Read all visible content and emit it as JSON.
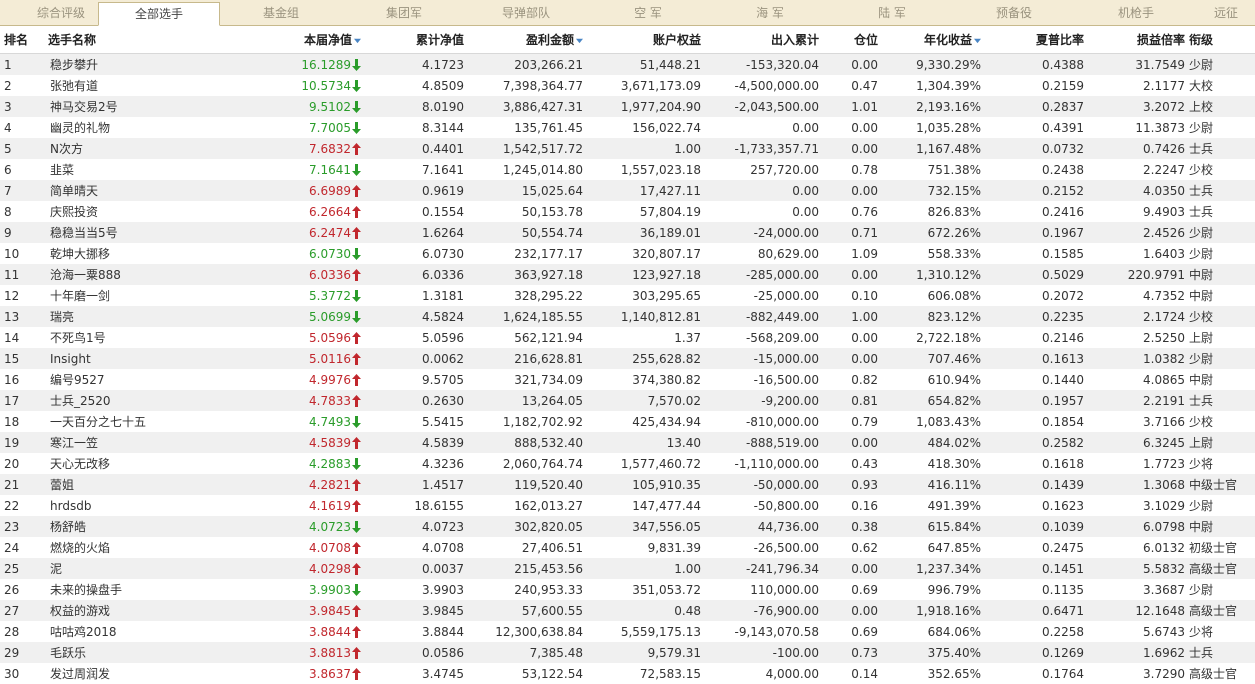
{
  "tabs": [
    {
      "label": "综合评级",
      "active": false
    },
    {
      "label": "全部选手",
      "active": true
    },
    {
      "label": "基金组",
      "active": false
    },
    {
      "label": "集团军",
      "active": false
    },
    {
      "label": "导弹部队",
      "active": false
    },
    {
      "label": "空  军",
      "active": false
    },
    {
      "label": "海  军",
      "active": false
    },
    {
      "label": "陆  军",
      "active": false
    },
    {
      "label": "预备役",
      "active": false
    },
    {
      "label": "机枪手",
      "active": false
    },
    {
      "label": "远征",
      "active": false
    }
  ],
  "columns": [
    {
      "label": "排名",
      "sortable": false
    },
    {
      "label": "选手名称",
      "sortable": false
    },
    {
      "label": "本届净值",
      "sortable": true
    },
    {
      "label": "累计净值",
      "sortable": false
    },
    {
      "label": "盈利金额",
      "sortable": true
    },
    {
      "label": "账户权益",
      "sortable": false
    },
    {
      "label": "出入累计",
      "sortable": false
    },
    {
      "label": "仓位",
      "sortable": false
    },
    {
      "label": "年化收益",
      "sortable": true
    },
    {
      "label": "夏普比率",
      "sortable": false
    },
    {
      "label": "损益倍率",
      "sortable": false
    },
    {
      "label": "衔级",
      "sortable": false
    }
  ],
  "colors": {
    "up": "#c1272d",
    "down": "#2a9c2a",
    "sort_icon": "#4a86c5"
  },
  "rows": [
    {
      "rank": "1",
      "name": "稳步攀升",
      "nav": "16.1289",
      "trend": "down",
      "cum_nav": "4.1723",
      "profit": "203,266.21",
      "equity": "51,448.21",
      "flow": "-153,320.04",
      "position": "0.00",
      "annual": "9,330.29%",
      "sharpe": "0.4388",
      "pl_ratio": "31.7549",
      "grade": "少尉"
    },
    {
      "rank": "2",
      "name": "张弛有道",
      "nav": "10.5734",
      "trend": "down",
      "cum_nav": "4.8509",
      "profit": "7,398,364.77",
      "equity": "3,671,173.09",
      "flow": "-4,500,000.00",
      "position": "0.47",
      "annual": "1,304.39%",
      "sharpe": "0.2159",
      "pl_ratio": "2.1177",
      "grade": "大校"
    },
    {
      "rank": "3",
      "name": "神马交易2号",
      "nav": "9.5102",
      "trend": "down",
      "cum_nav": "8.0190",
      "profit": "3,886,427.31",
      "equity": "1,977,204.90",
      "flow": "-2,043,500.00",
      "position": "1.01",
      "annual": "2,193.16%",
      "sharpe": "0.2837",
      "pl_ratio": "3.2072",
      "grade": "上校"
    },
    {
      "rank": "4",
      "name": "幽灵的礼物",
      "nav": "7.7005",
      "trend": "down",
      "cum_nav": "8.3144",
      "profit": "135,761.45",
      "equity": "156,022.74",
      "flow": "0.00",
      "position": "0.00",
      "annual": "1,035.28%",
      "sharpe": "0.4391",
      "pl_ratio": "11.3873",
      "grade": "少尉"
    },
    {
      "rank": "5",
      "name": "N次方",
      "nav": "7.6832",
      "trend": "up",
      "cum_nav": "0.4401",
      "profit": "1,542,517.72",
      "equity": "1.00",
      "flow": "-1,733,357.71",
      "position": "0.00",
      "annual": "1,167.48%",
      "sharpe": "0.0732",
      "pl_ratio": "0.7426",
      "grade": "士兵"
    },
    {
      "rank": "6",
      "name": "韭菜",
      "nav": "7.1641",
      "trend": "down",
      "cum_nav": "7.1641",
      "profit": "1,245,014.80",
      "equity": "1,557,023.18",
      "flow": "257,720.00",
      "position": "0.78",
      "annual": "751.38%",
      "sharpe": "0.2438",
      "pl_ratio": "2.2247",
      "grade": "少校"
    },
    {
      "rank": "7",
      "name": "简单晴天",
      "nav": "6.6989",
      "trend": "up",
      "cum_nav": "0.9619",
      "profit": "15,025.64",
      "equity": "17,427.11",
      "flow": "0.00",
      "position": "0.00",
      "annual": "732.15%",
      "sharpe": "0.2152",
      "pl_ratio": "4.0350",
      "grade": "士兵"
    },
    {
      "rank": "8",
      "name": "庆熙投资",
      "nav": "6.2664",
      "trend": "up",
      "cum_nav": "0.1554",
      "profit": "50,153.78",
      "equity": "57,804.19",
      "flow": "0.00",
      "position": "0.76",
      "annual": "826.83%",
      "sharpe": "0.2416",
      "pl_ratio": "9.4903",
      "grade": "士兵"
    },
    {
      "rank": "9",
      "name": "稳稳当当5号",
      "nav": "6.2474",
      "trend": "up",
      "cum_nav": "1.6264",
      "profit": "50,554.74",
      "equity": "36,189.01",
      "flow": "-24,000.00",
      "position": "0.71",
      "annual": "672.26%",
      "sharpe": "0.1967",
      "pl_ratio": "2.4526",
      "grade": "少尉"
    },
    {
      "rank": "10",
      "name": "乾坤大挪移",
      "nav": "6.0730",
      "trend": "down",
      "cum_nav": "6.0730",
      "profit": "232,177.17",
      "equity": "320,807.17",
      "flow": "80,629.00",
      "position": "1.09",
      "annual": "558.33%",
      "sharpe": "0.1585",
      "pl_ratio": "1.6403",
      "grade": "少尉"
    },
    {
      "rank": "11",
      "name": "沧海一粟888",
      "nav": "6.0336",
      "trend": "up",
      "cum_nav": "6.0336",
      "profit": "363,927.18",
      "equity": "123,927.18",
      "flow": "-285,000.00",
      "position": "0.00",
      "annual": "1,310.12%",
      "sharpe": "0.5029",
      "pl_ratio": "220.9791",
      "grade": "中尉"
    },
    {
      "rank": "12",
      "name": "十年磨一剑",
      "nav": "5.3772",
      "trend": "down",
      "cum_nav": "1.3181",
      "profit": "328,295.22",
      "equity": "303,295.65",
      "flow": "-25,000.00",
      "position": "0.10",
      "annual": "606.08%",
      "sharpe": "0.2072",
      "pl_ratio": "4.7352",
      "grade": "中尉"
    },
    {
      "rank": "13",
      "name": "瑞亮",
      "nav": "5.0699",
      "trend": "down",
      "cum_nav": "4.5824",
      "profit": "1,624,185.55",
      "equity": "1,140,812.81",
      "flow": "-882,449.00",
      "position": "1.00",
      "annual": "823.12%",
      "sharpe": "0.2235",
      "pl_ratio": "2.1724",
      "grade": "少校"
    },
    {
      "rank": "14",
      "name": "不死鸟1号",
      "nav": "5.0596",
      "trend": "up",
      "cum_nav": "5.0596",
      "profit": "562,121.94",
      "equity": "1.37",
      "flow": "-568,209.00",
      "position": "0.00",
      "annual": "2,722.18%",
      "sharpe": "0.2146",
      "pl_ratio": "2.5250",
      "grade": "上尉"
    },
    {
      "rank": "15",
      "name": "Insight",
      "nav": "5.0116",
      "trend": "up",
      "cum_nav": "0.0062",
      "profit": "216,628.81",
      "equity": "255,628.82",
      "flow": "-15,000.00",
      "position": "0.00",
      "annual": "707.46%",
      "sharpe": "0.1613",
      "pl_ratio": "1.0382",
      "grade": "少尉"
    },
    {
      "rank": "16",
      "name": "编号9527",
      "nav": "4.9976",
      "trend": "up",
      "cum_nav": "9.5705",
      "profit": "321,734.09",
      "equity": "374,380.82",
      "flow": "-16,500.00",
      "position": "0.82",
      "annual": "610.94%",
      "sharpe": "0.1440",
      "pl_ratio": "4.0865",
      "grade": "中尉"
    },
    {
      "rank": "17",
      "name": "士兵_2520",
      "nav": "4.7833",
      "trend": "up",
      "cum_nav": "0.2630",
      "profit": "13,264.05",
      "equity": "7,570.02",
      "flow": "-9,200.00",
      "position": "0.81",
      "annual": "654.82%",
      "sharpe": "0.1957",
      "pl_ratio": "2.2191",
      "grade": "士兵"
    },
    {
      "rank": "18",
      "name": "一天百分之七十五",
      "nav": "4.7493",
      "trend": "down",
      "cum_nav": "5.5415",
      "profit": "1,182,702.92",
      "equity": "425,434.94",
      "flow": "-810,000.00",
      "position": "0.79",
      "annual": "1,083.43%",
      "sharpe": "0.1854",
      "pl_ratio": "3.7166",
      "grade": "少校"
    },
    {
      "rank": "19",
      "name": "寒江一笠",
      "nav": "4.5839",
      "trend": "up",
      "cum_nav": "4.5839",
      "profit": "888,532.40",
      "equity": "13.40",
      "flow": "-888,519.00",
      "position": "0.00",
      "annual": "484.02%",
      "sharpe": "0.2582",
      "pl_ratio": "6.3245",
      "grade": "上尉"
    },
    {
      "rank": "20",
      "name": "天心无改移",
      "nav": "4.2883",
      "trend": "down",
      "cum_nav": "4.3236",
      "profit": "2,060,764.74",
      "equity": "1,577,460.72",
      "flow": "-1,110,000.00",
      "position": "0.43",
      "annual": "418.30%",
      "sharpe": "0.1618",
      "pl_ratio": "1.7723",
      "grade": "少将"
    },
    {
      "rank": "21",
      "name": "蕾姐",
      "nav": "4.2821",
      "trend": "up",
      "cum_nav": "1.4517",
      "profit": "119,520.40",
      "equity": "105,910.35",
      "flow": "-50,000.00",
      "position": "0.93",
      "annual": "416.11%",
      "sharpe": "0.1439",
      "pl_ratio": "1.3068",
      "grade": "中级士官"
    },
    {
      "rank": "22",
      "name": "hrdsdb",
      "nav": "4.1619",
      "trend": "up",
      "cum_nav": "18.6155",
      "profit": "162,013.27",
      "equity": "147,477.44",
      "flow": "-50,800.00",
      "position": "0.16",
      "annual": "491.39%",
      "sharpe": "0.1623",
      "pl_ratio": "3.1029",
      "grade": "少尉"
    },
    {
      "rank": "23",
      "name": "杨舒皓",
      "nav": "4.0723",
      "trend": "down",
      "cum_nav": "4.0723",
      "profit": "302,820.05",
      "equity": "347,556.05",
      "flow": "44,736.00",
      "position": "0.38",
      "annual": "615.84%",
      "sharpe": "0.1039",
      "pl_ratio": "6.0798",
      "grade": "中尉"
    },
    {
      "rank": "24",
      "name": "燃烧的火焰",
      "nav": "4.0708",
      "trend": "up",
      "cum_nav": "4.0708",
      "profit": "27,406.51",
      "equity": "9,831.39",
      "flow": "-26,500.00",
      "position": "0.62",
      "annual": "647.85%",
      "sharpe": "0.2475",
      "pl_ratio": "6.0132",
      "grade": "初级士官"
    },
    {
      "rank": "25",
      "name": "泥",
      "nav": "4.0298",
      "trend": "up",
      "cum_nav": "0.0037",
      "profit": "215,453.56",
      "equity": "1.00",
      "flow": "-241,796.34",
      "position": "0.00",
      "annual": "1,237.34%",
      "sharpe": "0.1451",
      "pl_ratio": "5.5832",
      "grade": "高级士官"
    },
    {
      "rank": "26",
      "name": "未来的操盘手",
      "nav": "3.9903",
      "trend": "down",
      "cum_nav": "3.9903",
      "profit": "240,953.33",
      "equity": "351,053.72",
      "flow": "110,000.00",
      "position": "0.69",
      "annual": "996.79%",
      "sharpe": "0.1135",
      "pl_ratio": "3.3687",
      "grade": "少尉"
    },
    {
      "rank": "27",
      "name": "权益的游戏",
      "nav": "3.9845",
      "trend": "up",
      "cum_nav": "3.9845",
      "profit": "57,600.55",
      "equity": "0.48",
      "flow": "-76,900.00",
      "position": "0.00",
      "annual": "1,918.16%",
      "sharpe": "0.6471",
      "pl_ratio": "12.1648",
      "grade": "高级士官"
    },
    {
      "rank": "28",
      "name": "咕咕鸡2018",
      "nav": "3.8844",
      "trend": "up",
      "cum_nav": "3.8844",
      "profit": "12,300,638.84",
      "equity": "5,559,175.13",
      "flow": "-9,143,070.58",
      "position": "0.69",
      "annual": "684.06%",
      "sharpe": "0.2258",
      "pl_ratio": "5.6743",
      "grade": "少将"
    },
    {
      "rank": "29",
      "name": "毛跃乐",
      "nav": "3.8813",
      "trend": "up",
      "cum_nav": "0.0586",
      "profit": "7,385.48",
      "equity": "9,579.31",
      "flow": "-100.00",
      "position": "0.73",
      "annual": "375.40%",
      "sharpe": "0.1269",
      "pl_ratio": "1.6962",
      "grade": "士兵"
    },
    {
      "rank": "30",
      "name": "发过周润发",
      "nav": "3.8637",
      "trend": "up",
      "cum_nav": "3.4745",
      "profit": "53,122.54",
      "equity": "72,583.15",
      "flow": "4,000.00",
      "position": "0.14",
      "annual": "352.65%",
      "sharpe": "0.1764",
      "pl_ratio": "3.7290",
      "grade": "高级士官"
    }
  ]
}
